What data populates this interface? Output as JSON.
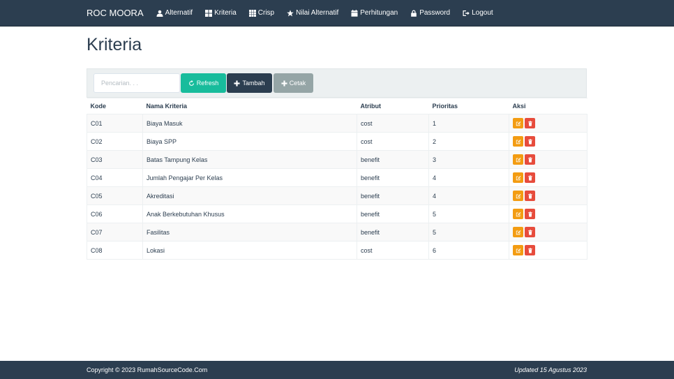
{
  "nav": {
    "brand": "ROC MOORA",
    "items": [
      {
        "label": "Alternatif",
        "icon": "user-icon"
      },
      {
        "label": "Kriteria",
        "icon": "th-large-icon"
      },
      {
        "label": "Crisp",
        "icon": "th-icon"
      },
      {
        "label": "Nilai Alternatif",
        "icon": "star-icon"
      },
      {
        "label": "Perhitungan",
        "icon": "calendar-icon"
      },
      {
        "label": "Password",
        "icon": "lock-icon"
      },
      {
        "label": "Logout",
        "icon": "log-out-icon"
      }
    ]
  },
  "page": {
    "title": "Kriteria"
  },
  "toolbar": {
    "search_placeholder": "Pencarian. . .",
    "search_value": "",
    "refresh_label": "Refresh",
    "tambah_label": "Tambah",
    "cetak_label": "Cetak"
  },
  "table": {
    "headers": [
      "Kode",
      "Nama Kriteria",
      "Atribut",
      "Prioritas",
      "Aksi"
    ],
    "rows": [
      {
        "kode": "C01",
        "nama": "Biaya Masuk",
        "atribut": "cost",
        "prioritas": "1"
      },
      {
        "kode": "C02",
        "nama": "Biaya SPP",
        "atribut": "cost",
        "prioritas": "2"
      },
      {
        "kode": "C03",
        "nama": "Batas Tampung Kelas",
        "atribut": "benefit",
        "prioritas": "3"
      },
      {
        "kode": "C04",
        "nama": "Jumlah Pengajar Per Kelas",
        "atribut": "benefit",
        "prioritas": "4"
      },
      {
        "kode": "C05",
        "nama": "Akreditasi",
        "atribut": "benefit",
        "prioritas": "4"
      },
      {
        "kode": "C06",
        "nama": "Anak Berkebutuhan Khusus",
        "atribut": "benefit",
        "prioritas": "5"
      },
      {
        "kode": "C07",
        "nama": "Fasilitas",
        "atribut": "benefit",
        "prioritas": "5"
      },
      {
        "kode": "C08",
        "nama": "Lokasi",
        "atribut": "cost",
        "prioritas": "6"
      }
    ]
  },
  "footer": {
    "copyright": "Copyright © 2023 RumahSourceCode.Com",
    "updated": "Updated 15 Agustus 2023"
  },
  "colors": {
    "navbar": "#2c3e50",
    "refresh": "#18bc9c",
    "tambah": "#2c3e50",
    "cetak": "#95a5a6",
    "edit": "#f39c12",
    "delete": "#e74c3c"
  }
}
